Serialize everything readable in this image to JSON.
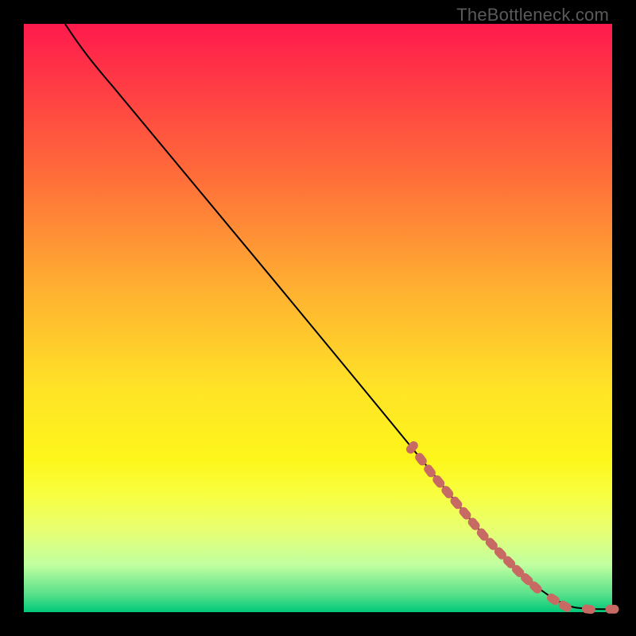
{
  "attribution": "TheBottleneck.com",
  "colors": {
    "dot": "#c76a63",
    "curve": "#000000"
  },
  "chart_data": {
    "type": "line",
    "title": "",
    "xlabel": "",
    "ylabel": "",
    "xlim": [
      0,
      100
    ],
    "ylim": [
      0,
      100
    ],
    "grid": false,
    "legend": false,
    "note": "Axes carry no tick labels; values are read as percentages of the plot area. The curve descends diagonally with a gentle shoulder at top-left and a flat tail at bottom-right. Dots (dashed-looking cluster) trace the lower-right segment of the curve.",
    "series": [
      {
        "name": "curve",
        "kind": "line",
        "x": [
          7,
          9,
          12,
          18,
          66,
          78,
          86,
          92,
          96,
          100
        ],
        "y": [
          100,
          97,
          93,
          86,
          28,
          13,
          5,
          1,
          0.5,
          0.5
        ]
      },
      {
        "name": "highlight-dots",
        "kind": "scatter",
        "x": [
          66,
          67.5,
          69,
          70.5,
          72,
          73.5,
          75,
          76.5,
          78,
          79.5,
          81,
          82.5,
          84,
          85.5,
          87,
          90,
          92,
          96,
          100
        ],
        "y": [
          28,
          26,
          24,
          22.2,
          20.4,
          18.6,
          16.8,
          15,
          13.2,
          11.6,
          10,
          8.5,
          7,
          5.6,
          4.2,
          2.2,
          1.0,
          0.5,
          0.5
        ]
      }
    ]
  }
}
